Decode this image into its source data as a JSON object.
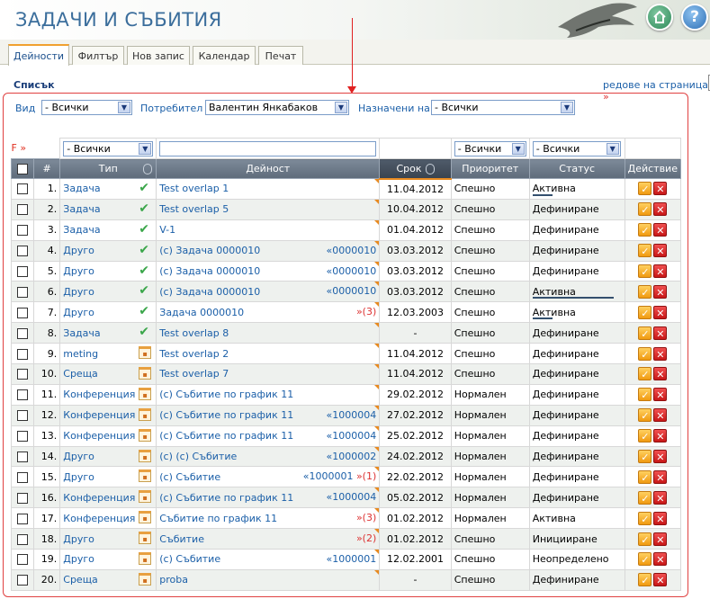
{
  "header": {
    "title": "ЗАДАЧИ И СЪБИТИЯ"
  },
  "tabs": [
    "Дейности",
    "Филтър",
    "Нов запис",
    "Календар",
    "Печат"
  ],
  "section_label": "Списък",
  "per_page": {
    "label": "редове на страница",
    "arrow": "»"
  },
  "filters": {
    "view_label": "Вид",
    "view_value": "- Всички",
    "user_label": "Потребител",
    "user_value": "Валентин Янкабаков",
    "assigned_label": "Назначени на",
    "assigned_value": "- Всички"
  },
  "column_filters": {
    "f_link": "F »",
    "type": "- Всички",
    "priority": "- Всички",
    "status": "- Всички"
  },
  "columns": {
    "num": "#",
    "type": "Тип",
    "activity": "Дейност",
    "deadline": "Срок",
    "priority": "Приоритет",
    "status": "Статус",
    "action": "Действие"
  },
  "rows": [
    {
      "n": "1.",
      "type": "Задача",
      "icon": "check-icon",
      "activity": "Test overlap 1",
      "ref": "",
      "ref2": "",
      "date": "11.04.2012",
      "priority": "Спешно",
      "status": "Активна",
      "ul": true
    },
    {
      "n": "2.",
      "type": "Задача",
      "icon": "check-icon",
      "activity": "Test overlap 5",
      "ref": "",
      "ref2": "",
      "date": "10.04.2012",
      "priority": "Спешно",
      "status": "Дефиниране",
      "ul": false
    },
    {
      "n": "3.",
      "type": "Задача",
      "icon": "check-icon",
      "activity": "V-1",
      "ref": "",
      "ref2": "",
      "date": "01.04.2012",
      "priority": "Спешно",
      "status": "Дефиниране",
      "ul": false
    },
    {
      "n": "4.",
      "type": "Друго",
      "icon": "check-icon",
      "activity": "(c) Задача 0000010",
      "ref": "«0000010",
      "ref2": "",
      "date": "03.03.2012",
      "priority": "Спешно",
      "status": "Дефиниране",
      "ul": false
    },
    {
      "n": "5.",
      "type": "Друго",
      "icon": "check-icon",
      "activity": "(c) Задача 0000010",
      "ref": "«0000010",
      "ref2": "",
      "date": "03.03.2012",
      "priority": "Спешно",
      "status": "Дефиниране",
      "ul": false
    },
    {
      "n": "6.",
      "type": "Друго",
      "icon": "check-icon",
      "activity": "(c) Задача 0000010",
      "ref": "«0000010",
      "ref2": "",
      "date": "03.03.2012",
      "priority": "Спешно",
      "status": "Активна",
      "ul": true
    },
    {
      "n": "7.",
      "type": "Друго",
      "icon": "check-icon",
      "activity": "Задача 0000010",
      "ref": "",
      "ref2": "»(3)",
      "date": "12.03.2003",
      "priority": "Спешно",
      "status": "Активна",
      "ul": true
    },
    {
      "n": "8.",
      "type": "Задача",
      "icon": "check-icon",
      "activity": "Test overlap 8",
      "ref": "",
      "ref2": "",
      "date": "-",
      "priority": "Спешно",
      "status": "Дефиниране",
      "ul": false
    },
    {
      "n": "9.",
      "type": "meting",
      "icon": "calendar-icon",
      "activity": "Test overlap 2",
      "ref": "",
      "ref2": "",
      "date": "11.04.2012",
      "priority": "Спешно",
      "status": "Дефиниране",
      "ul": false
    },
    {
      "n": "10.",
      "type": "Среща",
      "icon": "calendar-icon",
      "activity": "Test overlap 7",
      "ref": "",
      "ref2": "",
      "date": "11.04.2012",
      "priority": "Спешно",
      "status": "Дефиниране",
      "ul": false
    },
    {
      "n": "11.",
      "type": "Конференция",
      "icon": "calendar-icon",
      "activity": "(c) Събитие по график 11",
      "ref": "",
      "ref2": "",
      "date": "29.02.2012",
      "priority": "Нормален",
      "status": "Дефиниране",
      "ul": false
    },
    {
      "n": "12.",
      "type": "Конференция",
      "icon": "calendar-icon",
      "activity": "(c) Събитие по график 11",
      "ref": "«1000004",
      "ref2": "",
      "date": "27.02.2012",
      "priority": "Нормален",
      "status": "Дефиниране",
      "ul": false
    },
    {
      "n": "13.",
      "type": "Конференция",
      "icon": "calendar-icon",
      "activity": "(c) Събитие по график 11",
      "ref": "«1000004",
      "ref2": "",
      "date": "25.02.2012",
      "priority": "Нормален",
      "status": "Дефиниране",
      "ul": false
    },
    {
      "n": "14.",
      "type": "Друго",
      "icon": "calendar-icon",
      "activity": "(c) (c) Събитие",
      "ref": "«1000002",
      "ref2": "",
      "date": "24.02.2012",
      "priority": "Нормален",
      "status": "Дефиниране",
      "ul": false
    },
    {
      "n": "15.",
      "type": "Друго",
      "icon": "calendar-icon",
      "activity": "(c) Събитие",
      "ref": "«1000001",
      "ref2": "»(1)",
      "date": "22.02.2012",
      "priority": "Нормален",
      "status": "Дефиниране",
      "ul": false
    },
    {
      "n": "16.",
      "type": "Конференция",
      "icon": "calendar-icon",
      "activity": "(c) Събитие по график 11",
      "ref": "«1000004",
      "ref2": "",
      "date": "05.02.2012",
      "priority": "Нормален",
      "status": "Дефиниране",
      "ul": false
    },
    {
      "n": "17.",
      "type": "Конференция",
      "icon": "calendar-icon",
      "activity": "Събитие по график 11",
      "ref": "",
      "ref2": "»(3)",
      "date": "01.02.2012",
      "priority": "Нормален",
      "status": "Активна",
      "ul": false
    },
    {
      "n": "18.",
      "type": "Друго",
      "icon": "calendar-icon",
      "activity": "Събитие",
      "ref": "",
      "ref2": "»(2)",
      "date": "01.02.2012",
      "priority": "Спешно",
      "status": "Иницииране",
      "ul": false
    },
    {
      "n": "19.",
      "type": "Друго",
      "icon": "calendar-icon",
      "activity": "(c) Събитие",
      "ref": "«1000001",
      "ref2": "",
      "date": "12.02.2001",
      "priority": "Спешно",
      "status": "Неопределено",
      "ul": false
    },
    {
      "n": "20.",
      "type": "Среща",
      "icon": "calendar-icon",
      "activity": "proba",
      "ref": "",
      "ref2": "",
      "date": "-",
      "priority": "Спешно",
      "status": "Дефиниране",
      "ul": false
    }
  ]
}
